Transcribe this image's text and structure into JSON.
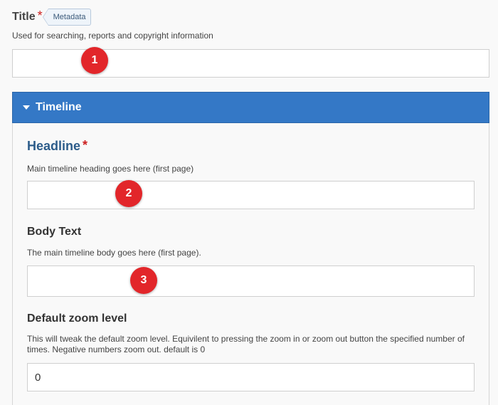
{
  "title_field": {
    "label": "Title",
    "required_mark": "*",
    "tag": "Metadata",
    "description": "Used for searching, reports and copyright information",
    "value": ""
  },
  "section": {
    "title": "Timeline",
    "header_color": "#3478c6"
  },
  "headline": {
    "label": "Headline",
    "required_mark": "*",
    "description": "Main timeline heading goes here (first page)",
    "value": ""
  },
  "body_text": {
    "label": "Body Text",
    "description": "The main timeline body goes here (first page).",
    "value": ""
  },
  "zoom": {
    "label": "Default zoom level",
    "description": "This will tweak the default zoom level. Equivilent to pressing the zoom in or zoom out button the specified number of times. Negative numbers zoom out. default is 0",
    "value": "0"
  },
  "markers": [
    "1",
    "2",
    "3"
  ],
  "colors": {
    "marker": "#e2262a",
    "required": "#cc1f1f",
    "headline_label": "#2c5c8a"
  }
}
